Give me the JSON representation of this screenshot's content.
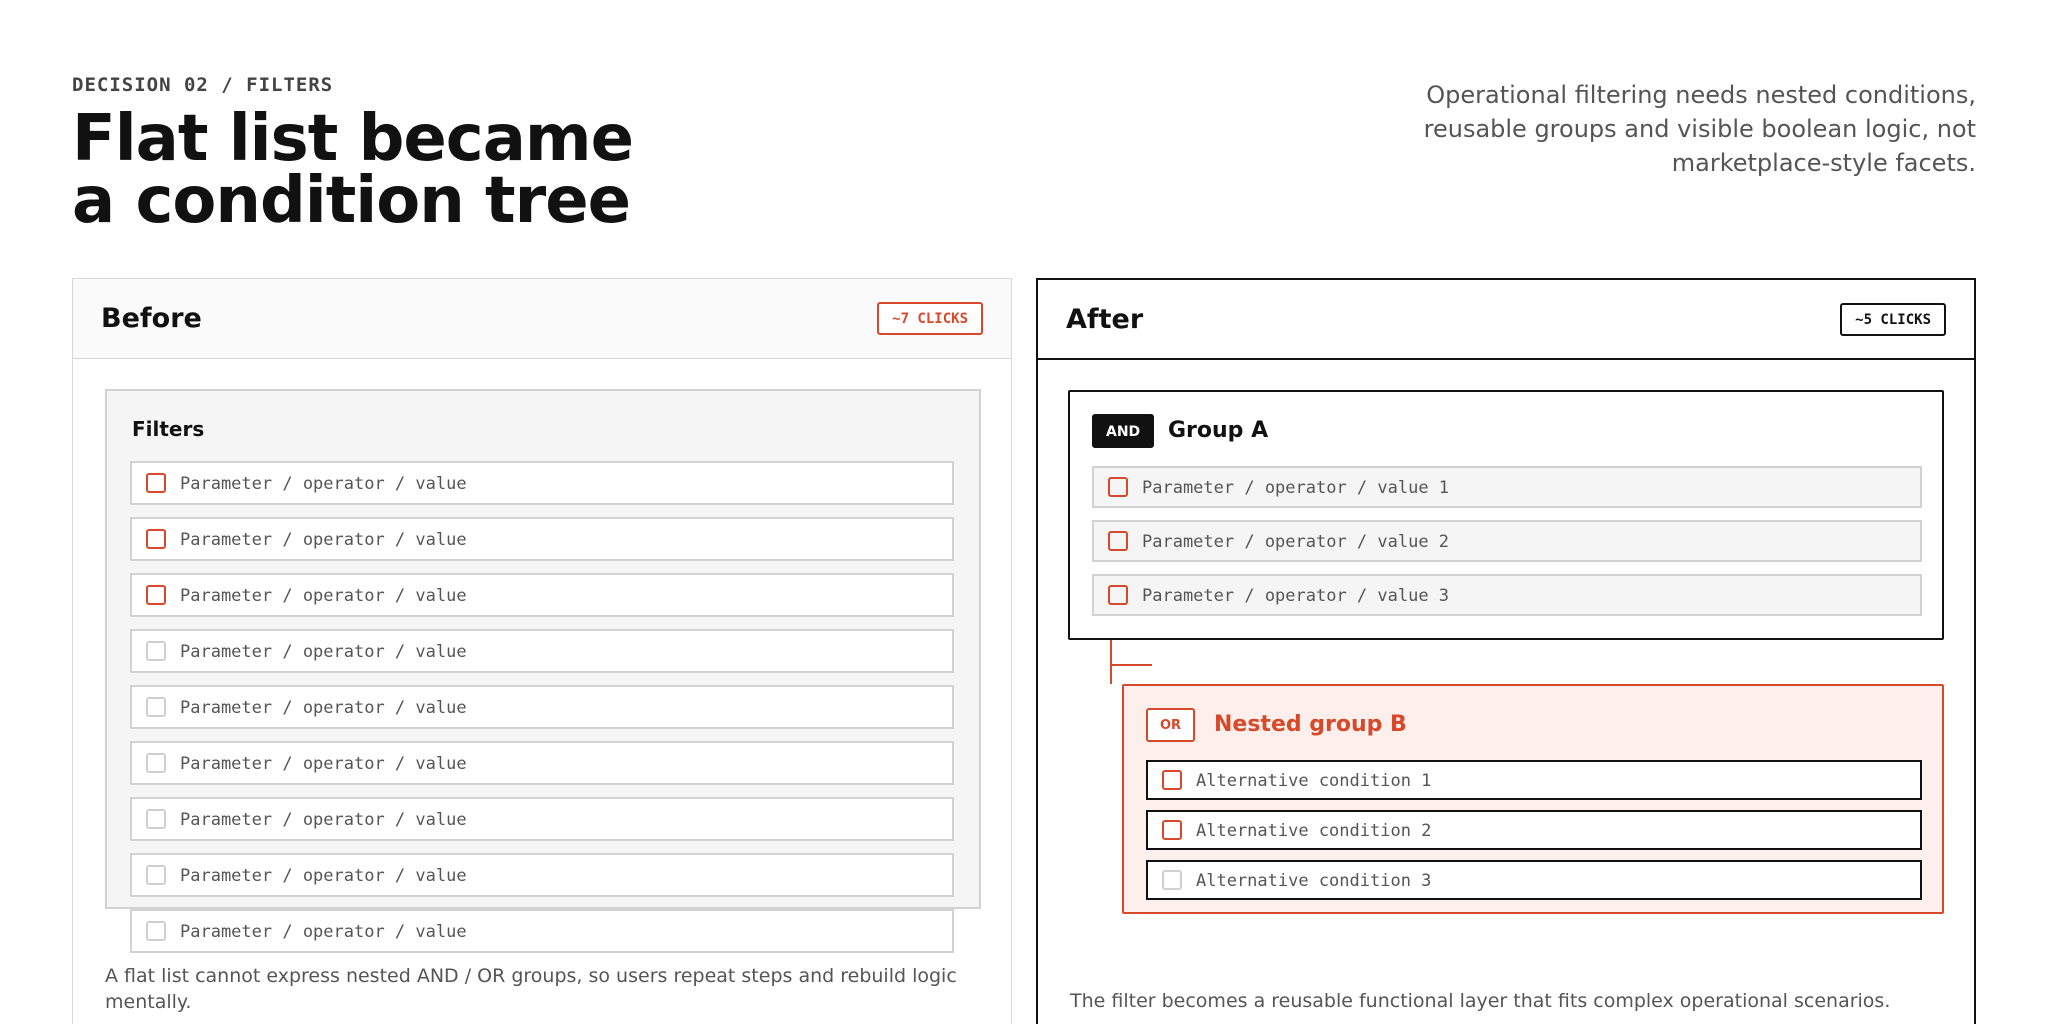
{
  "header": {
    "eyebrow": "DECISION 02 / FILTERS",
    "title_line1": "Flat list became",
    "title_line2": "a condition tree",
    "lead": "Operational filtering needs nested conditions, reusable groups and visible boolean logic, not marketplace-style facets."
  },
  "colors": {
    "accent": "#d6492a",
    "ink": "#111111",
    "muted": "#555555",
    "border": "#d2d2d2"
  },
  "before": {
    "title": "Before",
    "clicks": "~7 CLICKS",
    "filters_title": "Filters",
    "rows": [
      {
        "text": "Parameter / operator / value",
        "checkbox": "accent"
      },
      {
        "text": "Parameter / operator / value",
        "checkbox": "accent"
      },
      {
        "text": "Parameter / operator / value",
        "checkbox": "accent"
      },
      {
        "text": "Parameter / operator / value",
        "checkbox": "plain"
      },
      {
        "text": "Parameter / operator / value",
        "checkbox": "plain"
      },
      {
        "text": "Parameter / operator / value",
        "checkbox": "plain"
      },
      {
        "text": "Parameter / operator / value",
        "checkbox": "plain"
      },
      {
        "text": "Parameter / operator / value",
        "checkbox": "plain"
      },
      {
        "text": "Parameter / operator / value",
        "checkbox": "plain"
      }
    ],
    "note": "A flat list cannot express nested AND / OR groups, so users repeat steps and rebuild logic mentally."
  },
  "after": {
    "title": "After",
    "clicks": "~5 CLICKS",
    "group_a": {
      "operator": "AND",
      "title": "Group A",
      "rows": [
        "Parameter / operator / value 1",
        "Parameter / operator / value 2",
        "Parameter / operator / value 3"
      ]
    },
    "group_b": {
      "operator": "OR",
      "title": "Nested group B",
      "rows": [
        {
          "text": "Alternative condition 1",
          "checkbox": "accent"
        },
        {
          "text": "Alternative condition 2",
          "checkbox": "accent"
        },
        {
          "text": "Alternative condition 3",
          "checkbox": "plain"
        }
      ]
    },
    "note": "The filter becomes a reusable functional layer that fits complex operational scenarios."
  }
}
